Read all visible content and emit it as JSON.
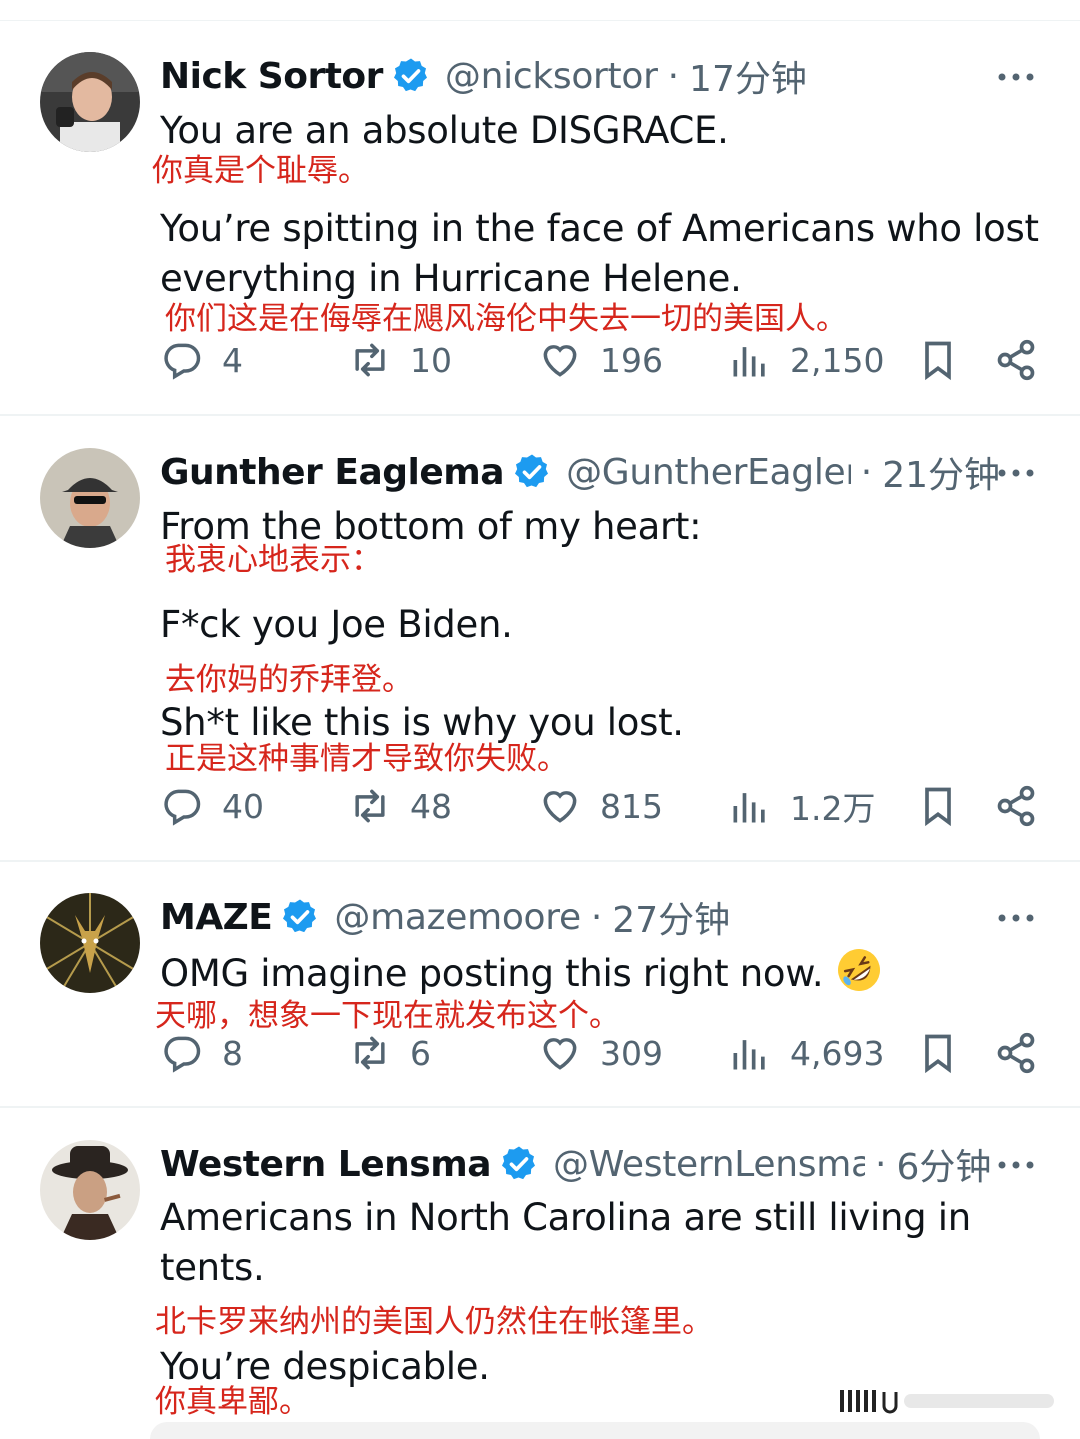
{
  "colors": {
    "text": "#0f1419",
    "muted": "#536471",
    "verified": "#1d9bf0",
    "translation": "#d6261c",
    "separator": "#eff3f4"
  },
  "tweets": [
    {
      "name": "Nick Sortor",
      "handle": "@nicksortor",
      "time": "17分钟",
      "lines": [
        {
          "en": "You are an absolute DISGRACE.",
          "zh": "你真是个耻辱。"
        },
        {
          "en": "You’re spitting in the face of Americans who lost",
          "en2": "everything in Hurricane Helene.",
          "zh": "你们这是在侮辱在飓风海伦中失去一切的美国人。"
        }
      ],
      "replies": "4",
      "retweets": "10",
      "likes": "196",
      "views": "2,150"
    },
    {
      "name": "Gunther Eaglema",
      "handle": "@GuntherEagler",
      "time": "21分钟",
      "lines": [
        {
          "en": "From the bottom of my heart:",
          "zh": "我衷心地表示："
        },
        {
          "en": "F*ck you Joe Biden.",
          "zh": "去你妈的乔拜登。"
        },
        {
          "en": "Sh*t like this is why you lost.",
          "zh": "正是这种事情才导致你失败。"
        }
      ],
      "replies": "40",
      "retweets": "48",
      "likes": "815",
      "views": "1.2万"
    },
    {
      "name": "MAZE",
      "handle": "@mazemoore",
      "time": "27分钟",
      "lines": [
        {
          "en": "OMG imagine posting this right now.",
          "emoji": "rolling-on-floor-laughing",
          "zh": "天哪，想象一下现在就发布这个。"
        }
      ],
      "replies": "8",
      "retweets": "6",
      "likes": "309",
      "views": "4,693"
    },
    {
      "name": "Western Lensma",
      "handle": "@WesternLensma",
      "time": "6分钟",
      "lines": [
        {
          "en": "Americans in North Carolina are still living in",
          "en2": "tents.",
          "zh": "北卡罗来纳州的美国人仍然住在帐篷里。"
        },
        {
          "en": "You’re despicable.",
          "zh": "你真卑鄙。"
        }
      ]
    }
  ],
  "icons": {
    "reply": "speech-bubble-icon",
    "retweet": "retweet-icon",
    "like": "heart-icon",
    "views": "bar-chart-icon",
    "bookmark": "bookmark-icon",
    "share": "share-icon",
    "more": "more-dots-icon",
    "verified": "verified-badge-icon"
  }
}
